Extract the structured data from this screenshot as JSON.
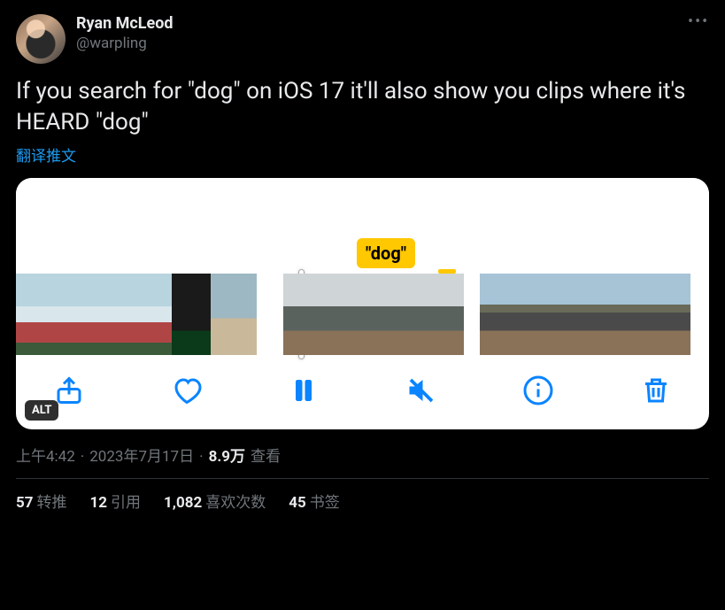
{
  "tweet": {
    "author": {
      "display_name": "Ryan McLeod",
      "handle": "@warpling"
    },
    "text": "If you search for \"dog\" on iOS 17 it'll also show you clips where it's HEARD \"dog\"",
    "translate_label": "翻译推文",
    "media": {
      "tag_text": "\"dog\"",
      "alt_badge": "ALT",
      "toolbar_icons": [
        "share-icon",
        "heart-icon",
        "pause-icon",
        "mute-icon",
        "info-icon",
        "trash-icon"
      ]
    },
    "meta": {
      "time": "上午4:42",
      "date": "2023年7月17日",
      "views_count": "8.9万",
      "views_label": "查看"
    },
    "stats": {
      "retweets": {
        "count": "57",
        "label": "转推"
      },
      "quotes": {
        "count": "12",
        "label": "引用"
      },
      "likes": {
        "count": "1,082",
        "label": "喜欢次数"
      },
      "bookmarks": {
        "count": "45",
        "label": "书签"
      }
    }
  }
}
